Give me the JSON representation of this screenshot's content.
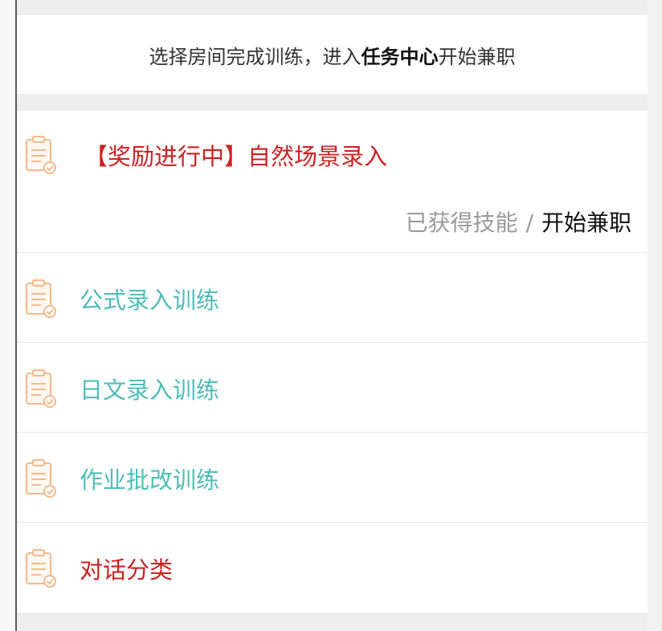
{
  "intro": {
    "prefix": "选择房间完成训练，进入",
    "highlight": "任务中心",
    "suffix": "开始兼职"
  },
  "featured": {
    "title": "【奖励进行中】自然场景录入",
    "skill_status": "已获得技能",
    "separator": "/",
    "action": "开始兼职"
  },
  "tasks": [
    {
      "title": "公式录入训练",
      "color": "#4fbcb8"
    },
    {
      "title": "日文录入训练",
      "color": "#4fbcb8"
    },
    {
      "title": "作业批改训练",
      "color": "#4fbcb8"
    },
    {
      "title": "对话分类",
      "color": "#cc2020"
    }
  ],
  "colors": {
    "accent_red": "#cc2020",
    "accent_teal": "#4fbcb8",
    "icon_orange": "#f3b98a",
    "background": "#eeeeee"
  },
  "icons": {
    "task_icon": "clipboard-check-icon"
  }
}
